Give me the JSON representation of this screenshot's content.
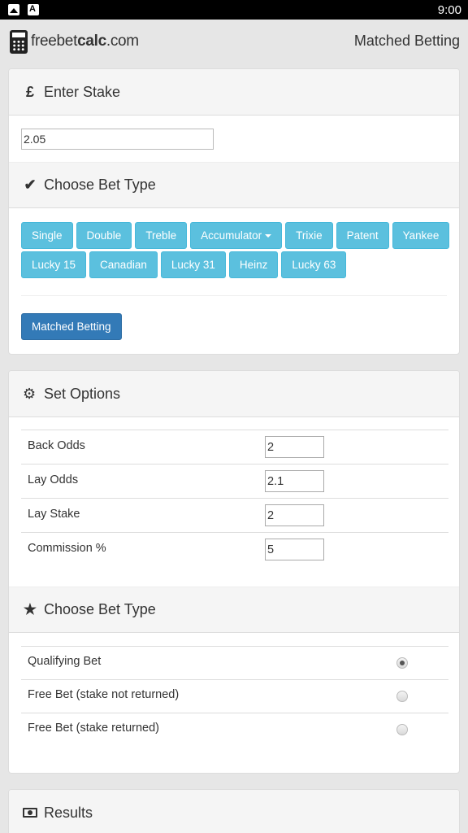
{
  "status": {
    "time": "9:00"
  },
  "header": {
    "logo_plain": "freebet",
    "logo_bold": "calc",
    "logo_suffix": ".com",
    "title": "Matched Betting"
  },
  "stake": {
    "heading": "Enter Stake",
    "icon": "pound-icon",
    "value": "2.05"
  },
  "bet_type": {
    "heading": "Choose Bet Type",
    "icon": "check-icon",
    "row1": [
      "Single",
      "Double",
      "Treble",
      "Accumulator",
      "Trixie",
      "Patent",
      "Yankee"
    ],
    "row2": [
      "Lucky 15",
      "Canadian",
      "Lucky 31",
      "Heinz",
      "Lucky 63"
    ],
    "primary_button": "Matched Betting"
  },
  "options": {
    "heading": "Set Options",
    "icon": "gear-icon",
    "rows": [
      {
        "label": "Back Odds",
        "value": "2"
      },
      {
        "label": "Lay Odds",
        "value": "2.1"
      },
      {
        "label": "Lay Stake",
        "value": "2"
      },
      {
        "label": "Commission %",
        "value": "5"
      }
    ]
  },
  "bet_kind": {
    "heading": "Choose Bet Type",
    "icon": "star-icon",
    "options": [
      {
        "label": "Qualifying Bet",
        "selected": true
      },
      {
        "label": "Free Bet (stake not returned)",
        "selected": false
      },
      {
        "label": "Free Bet (stake returned)",
        "selected": false
      }
    ]
  },
  "results": {
    "heading": "Results",
    "icon": "money-icon"
  },
  "colors": {
    "info": "#5bc0de",
    "primary": "#337ab7",
    "background": "#e6e6e6"
  }
}
